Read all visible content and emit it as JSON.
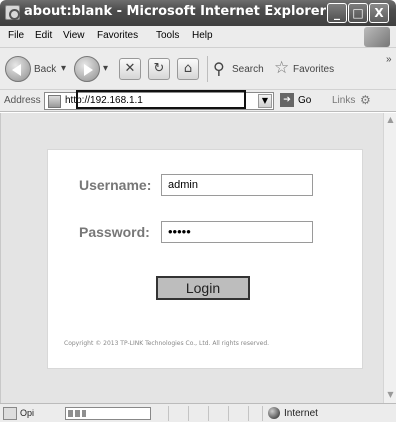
{
  "window": {
    "title": "about:blank - Microsoft Internet Explorer",
    "min_glyph": "_",
    "max_glyph": "□",
    "close_glyph": "X"
  },
  "menu": {
    "items": [
      {
        "label": "File"
      },
      {
        "label": "Edit"
      },
      {
        "label": "View"
      },
      {
        "label": "Favorites"
      },
      {
        "label": "Tools"
      },
      {
        "label": "Help"
      }
    ]
  },
  "toolbar": {
    "back_label": "Back",
    "search_label": "Search",
    "favorites_label": "Favorites",
    "more_glyph": "»"
  },
  "addressbar": {
    "label": "Address",
    "url": "http://192.168.1.1",
    "go_label": "Go",
    "links_label": "Links"
  },
  "login": {
    "username_label": "Username:",
    "username_value": "admin",
    "password_label": "Password:",
    "password_value": "•••••",
    "button_label": "Login",
    "copyright": "Copyright © 2013 TP-LINK Technologies Co., Ltd. All rights reserved."
  },
  "statusbar": {
    "status_text": "Opi",
    "zone": "Internet"
  },
  "colors": {
    "titlebar": "#4c4c4c",
    "content_bg": "#e4e4e4",
    "panel_bg": "#ffffff",
    "label_color": "#777777",
    "button_bg": "#bdbdbd"
  }
}
